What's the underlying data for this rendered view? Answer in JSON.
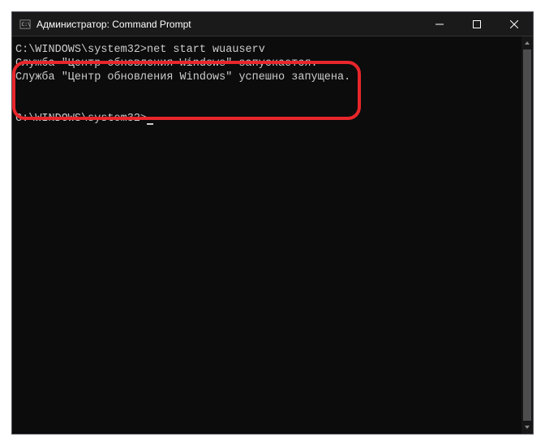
{
  "window": {
    "title": "Администратор: Command Prompt"
  },
  "terminal": {
    "prompt1": "C:\\WINDOWS\\system32>",
    "command1": "net start wuauserv",
    "output_line1": "Служба \"Центр обновления Windows\" запускается.",
    "output_line2": "Служба \"Центр обновления Windows\" успешно запущена.",
    "prompt2": "C:\\WINDOWS\\system32>"
  }
}
